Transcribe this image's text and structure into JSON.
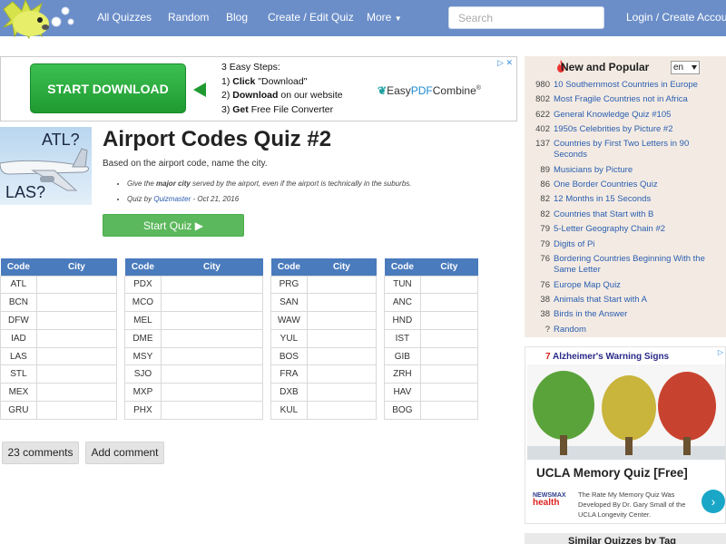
{
  "nav": {
    "items": [
      "All Quizzes",
      "Random",
      "Blog",
      "Create / Edit Quiz",
      "More"
    ],
    "search_placeholder": "Search",
    "login": "Login / Create Account"
  },
  "ad": {
    "button": "START DOWNLOAD",
    "steps_title": "3 Easy Steps:",
    "step1_prefix": "1) ",
    "step1_bold": "Click",
    "step1_rest": " \"Download\"",
    "step2_prefix": "2) ",
    "step2_bold": "Download",
    "step2_rest": " on our website",
    "step3_prefix": "3) ",
    "step3_bold": "Get",
    "step3_rest": " Free File Converter",
    "brand_easy": "Easy",
    "brand_pdf": "PDF",
    "brand_combine": "Combine",
    "brand_tm": "®"
  },
  "quiz": {
    "thumb_top": "ATL?",
    "thumb_bottom": "LAS?",
    "title": "Airport Codes Quiz #2",
    "description": "Based on the airport code, name the city.",
    "bullet1_pre": "Give the ",
    "bullet1_bold": "major city",
    "bullet1_post": " served by the airport, even if the airport is technically in the suburbs.",
    "bullet2_pre": "Quiz by ",
    "bullet2_author": "Quizmaster",
    "bullet2_post": " - Oct 21, 2016",
    "start_button": "Start Quiz ▶"
  },
  "table_headers": {
    "code": "Code",
    "city": "City"
  },
  "tables": [
    [
      "ATL",
      "BCN",
      "DFW",
      "IAD",
      "LAS",
      "STL",
      "MEX",
      "GRU"
    ],
    [
      "PDX",
      "MCO",
      "MEL",
      "DME",
      "MSY",
      "SJO",
      "MXP",
      "PHX"
    ],
    [
      "PRG",
      "SAN",
      "WAW",
      "YUL",
      "BOS",
      "FRA",
      "DXB",
      "KUL"
    ],
    [
      "TUN",
      "ANC",
      "HND",
      "IST",
      "GIB",
      "ZRH",
      "HAV",
      "BOG"
    ]
  ],
  "comments": {
    "count_label": "23 comments",
    "add_label": "Add comment"
  },
  "sidebar": {
    "title": "New and Popular",
    "language": "en",
    "popular": [
      {
        "count": "980",
        "title": "10 Southernmost Countries in Europe"
      },
      {
        "count": "802",
        "title": "Most Fragile Countries not in Africa"
      },
      {
        "count": "622",
        "title": "General Knowledge Quiz #105"
      },
      {
        "count": "402",
        "title": "1950s Celebrities by Picture #2"
      },
      {
        "count": "137",
        "title": "Countries by First Two Letters in 90 Seconds"
      },
      {
        "count": "89",
        "title": "Musicians by Picture"
      },
      {
        "count": "86",
        "title": "One Border Countries Quiz"
      },
      {
        "count": "82",
        "title": "12 Months in 15 Seconds"
      },
      {
        "count": "82",
        "title": "Countries that Start with B"
      },
      {
        "count": "79",
        "title": "5-Letter Geography Chain #2"
      },
      {
        "count": "79",
        "title": "Digits of Pi"
      },
      {
        "count": "76",
        "title": "Bordering Countries Beginning With the Same Letter"
      },
      {
        "count": "76",
        "title": "Europe Map Quiz"
      },
      {
        "count": "38",
        "title": "Animals that Start with A"
      },
      {
        "count": "38",
        "title": "Birds in the Answer"
      },
      {
        "count": "?",
        "title": "Random"
      }
    ],
    "ad_head_num": "7",
    "ad_head_text": " Alzheimer's Warning Signs",
    "ad_title": "UCLA Memory Quiz [Free]",
    "ad_body": "The Rate My Memory Quiz Was Developed By Dr. Gary Small of the UCLA Longevity Center.",
    "ad_logo_top": "NEWSMAX",
    "ad_logo_bottom": "health",
    "similar_title": "Similar Quizzes by Tag"
  },
  "colors": {
    "nav": "#6b8ec9",
    "table_header": "#4a7bbd",
    "start": "#5cb85c",
    "link": "#2a5db0",
    "sidebar_bg": "#f3ebe3"
  }
}
